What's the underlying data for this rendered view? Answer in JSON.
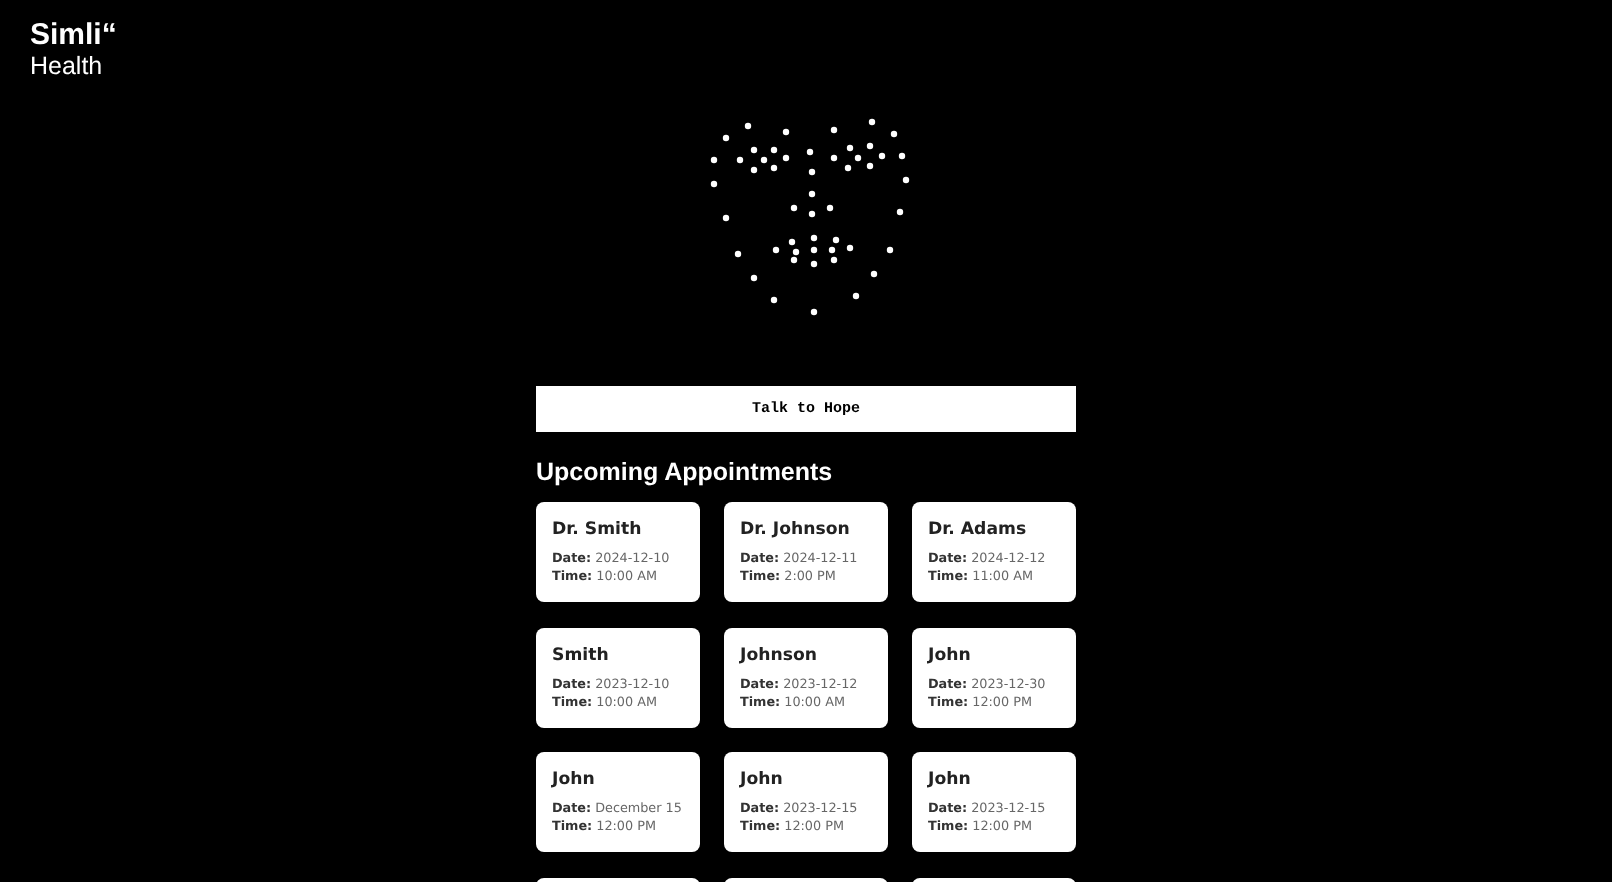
{
  "logo": {
    "name": "Simli“",
    "subtitle": "Health"
  },
  "talk_button": {
    "label": "Talk to Hope"
  },
  "appointments": {
    "title": "Upcoming Appointments",
    "cards": [
      {
        "kind": "full",
        "doctor": "Dr. Smith",
        "date": "**Date:** 2024-12-10",
        "time": "**Time:** 10:00 AM"
      },
      {
        "kind": "full",
        "doctor": "Dr. Johnson",
        "date": "**Date:** 2024-12-11",
        "time": "**Time:** 2:00 PM"
      },
      {
        "kind": "full",
        "doctor": "Dr. Adams",
        "date": "**Date:** 2024-12-12",
        "time": "**Time:** 11:00 AM"
      },
      {
        "kind": "full",
        "doctor": "Smith",
        "date": "**Date:** 2023-12-10",
        "time": "**Time:** 10:00 AM"
      },
      {
        "kind": "full",
        "doctor": "Johnson",
        "date": "**Date:** 2023-12-12",
        "time": "**Time:** 10:00 AM"
      },
      {
        "kind": "full",
        "doctor": "John",
        "date": "**Date:** 2023-12-30",
        "time": "**Time:** 12:00 PM"
      },
      {
        "kind": "full",
        "doctor": "John",
        "date": "**Date:** December 15",
        "time": "**Time:** 12:00 PM"
      },
      {
        "kind": "full",
        "doctor": "John",
        "date": "**Date:** 2023-12-15",
        "time": "**Time:** 12:00 PM"
      },
      {
        "kind": "full",
        "doctor": "John",
        "date": "**Date:** 2023-12-15",
        "time": "**Time:** 12:00 PM"
      },
      {
        "kind": "cut_off"
      },
      {
        "kind": "cut_off"
      },
      {
        "kind": "cut_off"
      }
    ]
  }
}
